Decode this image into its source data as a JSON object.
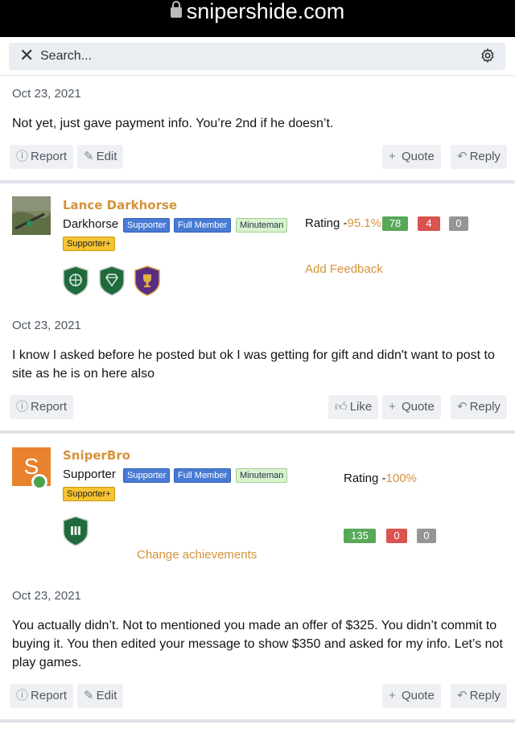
{
  "browser": {
    "domain": "snipershide.com"
  },
  "search": {
    "placeholder": "Search..."
  },
  "post1": {
    "date": "Oct 23, 2021",
    "text": "Not yet, just gave payment info. You’re 2nd if he doesn’t.",
    "actions": {
      "report": "Report",
      "edit": "Edit",
      "quote": "Quote",
      "reply": "Reply"
    }
  },
  "user1": {
    "name": "Lance Darkhorse",
    "title": "Darkhorse",
    "badges": [
      "Supporter",
      "Full Member",
      "Minuteman"
    ],
    "badge_plus": "Supporter+",
    "rating_label": "Rating -",
    "rating_pct": "95.1%",
    "positive": "78",
    "negative": "4",
    "neutral": "0",
    "feedback_link": "Add Feedback",
    "trophies": [
      "globe-shield-icon",
      "diamond-shield-icon",
      "trophy-shield-icon"
    ]
  },
  "post2": {
    "date": "Oct 23, 2021",
    "text": "I know I asked before he posted but ok I was getting for gift and didn't want to post to site as he is on here also",
    "actions": {
      "report": "Report",
      "like": "Like",
      "quote": "Quote",
      "reply": "Reply"
    }
  },
  "user2": {
    "avatar_letter": "S",
    "name": "SniperBro",
    "title": "Supporter",
    "badges": [
      "Supporter",
      "Full Member",
      "Minuteman"
    ],
    "badge_plus": "Supporter+",
    "rating_label": "Rating -",
    "rating_pct": "100%",
    "positive": "135",
    "negative": "0",
    "neutral": "0",
    "achievements_link": "Change achievements",
    "trophies": [
      "ammo-shield-icon"
    ]
  },
  "post3": {
    "date": "Oct 23, 2021",
    "text": "You actually didn’t. Not to mentioned you made an offer of $325. You didn’t commit to buying it. You then edited your message to show $350 and asked for my info. Let’s not play games.",
    "actions": {
      "report": "Report",
      "edit": "Edit",
      "quote": "Quote",
      "reply": "Reply"
    }
  },
  "colors": {
    "accent": "#d4933a",
    "badge_blue": "#4a7bd4",
    "positive": "#58a858",
    "negative": "#d9534f",
    "neutral": "#959595"
  }
}
